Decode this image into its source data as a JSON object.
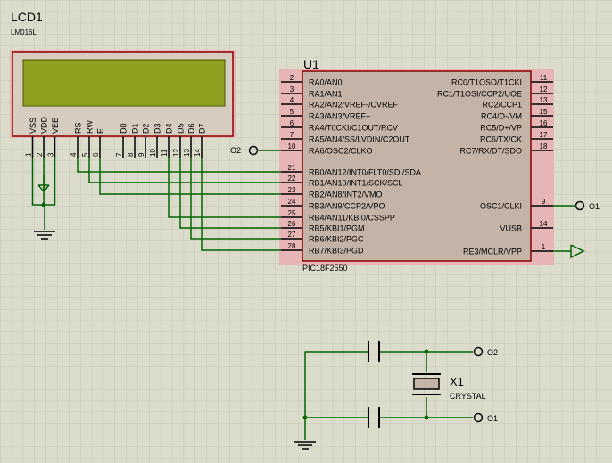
{
  "colors": {
    "background": "#dcdccc",
    "grid": "#c6c6b6",
    "wire": "#006400",
    "body_fill": "#c4b4a8",
    "body_stroke": "#8b0000",
    "text": "#000000",
    "lcd_screen": "#8fa020",
    "lcd_bezel": "#d6ccc0",
    "pink": "#e7b5b5"
  },
  "lcd": {
    "ref": "LCD1",
    "part": "LM016L",
    "pins": [
      {
        "name": "VSS",
        "num": "1"
      },
      {
        "name": "VDD",
        "num": "2"
      },
      {
        "name": "VEE",
        "num": "3"
      },
      {
        "name": "RS",
        "num": "4"
      },
      {
        "name": "RW",
        "num": "5"
      },
      {
        "name": "E",
        "num": "6"
      },
      {
        "name": "D0",
        "num": "7"
      },
      {
        "name": "D1",
        "num": "8"
      },
      {
        "name": "D2",
        "num": "9"
      },
      {
        "name": "D3",
        "num": "10"
      },
      {
        "name": "D4",
        "num": "11"
      },
      {
        "name": "D5",
        "num": "12"
      },
      {
        "name": "D6",
        "num": "13"
      },
      {
        "name": "D7",
        "num": "14"
      }
    ]
  },
  "mcu": {
    "ref": "U1",
    "part": "PIC18F2550",
    "left_pins": [
      {
        "num": "2",
        "label": "RA0/AN0"
      },
      {
        "num": "3",
        "label": "RA1/AN1"
      },
      {
        "num": "4",
        "label": "RA2/AN2/VREF-/CVREF"
      },
      {
        "num": "5",
        "label": "RA3/AN3/VREF+"
      },
      {
        "num": "6",
        "label": "RA4/T0CKI/C1OUT/RCV"
      },
      {
        "num": "7",
        "label": "RA5/AN4/SS/LVDIN/C2OUT"
      },
      {
        "num": "10",
        "label": "RA6/OSC2/CLKO"
      },
      {
        "num": "21",
        "label": "RB0/AN12/INT0/FLT0/SDI/SDA"
      },
      {
        "num": "22",
        "label": "RB1/AN10/INT1/SCK/SCL"
      },
      {
        "num": "23",
        "label": "RB2/AN8/INT2/VMO"
      },
      {
        "num": "24",
        "label": "RB3/AN9/CCP2/VPO"
      },
      {
        "num": "25",
        "label": "RB4/AN11/KBI0/CSSPP"
      },
      {
        "num": "26",
        "label": "RB5/KBI1/PGM"
      },
      {
        "num": "27",
        "label": "RB6/KBI2/PGC"
      },
      {
        "num": "28",
        "label": "RB7/KBI3/PGD"
      }
    ],
    "right_pins": [
      {
        "num": "11",
        "label": "RC0/T1OSO/T1CKI"
      },
      {
        "num": "12",
        "label": "RC1/T1OSI/CCP2/UOE"
      },
      {
        "num": "13",
        "label": "RC2/CCP1"
      },
      {
        "num": "15",
        "label": "RC4/D-/VM"
      },
      {
        "num": "16",
        "label": "RC5/D+/VP"
      },
      {
        "num": "17",
        "label": "RC6/TX/CK"
      },
      {
        "num": "18",
        "label": "RC7/RX/DT/SDO"
      },
      {
        "num": "9",
        "label": "OSC1/CLKI"
      },
      {
        "num": "14",
        "label": "VUSB"
      },
      {
        "num": "1",
        "label": "RE3/MCLR/VPP"
      }
    ]
  },
  "terminals": {
    "o2_left": "O2",
    "o1_right": "O1",
    "o2_crystal": "O2",
    "o1_crystal": "O1"
  },
  "crystal": {
    "ref": "X1",
    "part": "CRYSTAL"
  }
}
